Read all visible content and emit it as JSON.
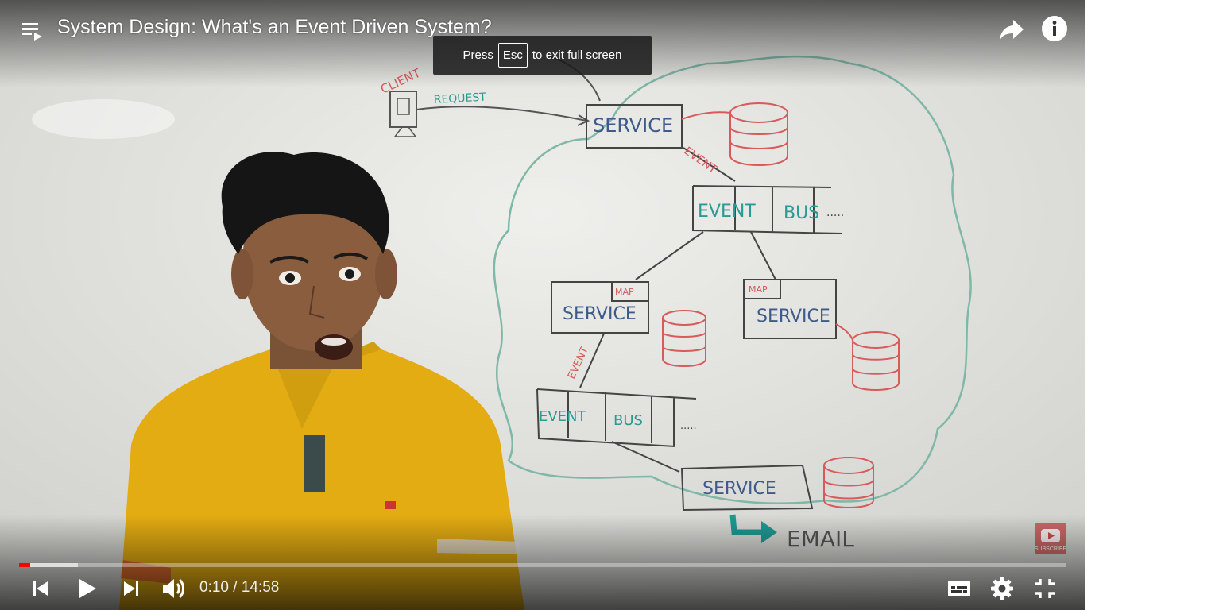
{
  "video": {
    "title": "System Design: What's an Event Driven System?",
    "current_time": "0:10",
    "duration": "14:58",
    "played_fraction": 0.011,
    "buffered_fraction": 0.056
  },
  "toast": {
    "prefix": "Press",
    "key": "Esc",
    "suffix": "to exit full screen"
  },
  "whiteboard": {
    "client": "CLIENT",
    "request": "REQUEST",
    "service": "SERVICE",
    "event": "EVENT",
    "bus": "BUS",
    "map": "MAP",
    "email": "EMAIL",
    "dots": "....."
  },
  "watermark": {
    "label": "SUBSCRIBE"
  },
  "colors": {
    "progress_played": "#ff0000",
    "toast_bg": "#1c1c1c",
    "shirt": "#e3ac12",
    "marker_blue": "#3d5a8a",
    "marker_teal": "#2a9a94",
    "marker_red": "#d85a5a"
  },
  "icons": {
    "playlist": "playlist-icon",
    "share": "share-icon",
    "info": "info-icon",
    "previous": "previous-icon",
    "play": "play-icon",
    "next": "next-icon",
    "volume": "volume-icon",
    "subtitles": "subtitles-icon",
    "settings": "settings-icon",
    "exit_fullscreen": "exit-fullscreen-icon"
  }
}
